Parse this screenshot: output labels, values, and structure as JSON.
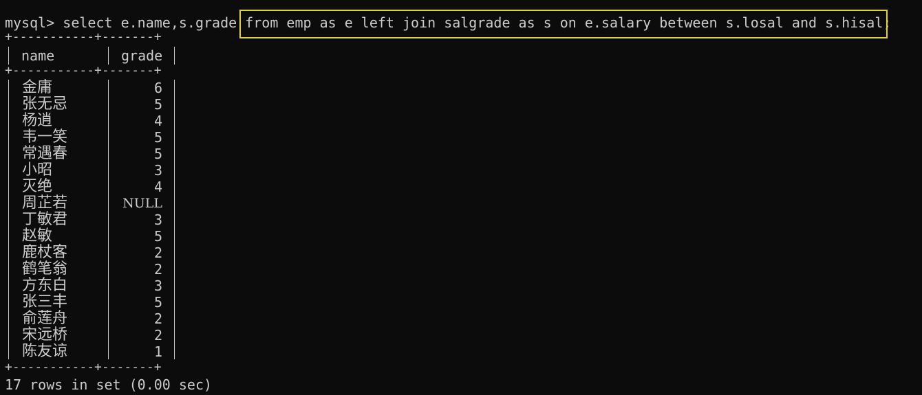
{
  "terminal": {
    "prompt": "mysql>",
    "command_prefix": " select e.name,s.grade ",
    "command_highlight": "from emp as e left join salgrade as s on e.salary between s.losal and s.hisal;",
    "border": "+-----------+-------+",
    "columns": [
      "name",
      "grade"
    ],
    "rows": [
      {
        "name": "金庸",
        "grade": "6"
      },
      {
        "name": "张无忌",
        "grade": "5"
      },
      {
        "name": "杨逍",
        "grade": "4"
      },
      {
        "name": "韦一笑",
        "grade": "5"
      },
      {
        "name": "常遇春",
        "grade": "5"
      },
      {
        "name": "小昭",
        "grade": "3"
      },
      {
        "name": "灭绝",
        "grade": "4"
      },
      {
        "name": "周芷若",
        "grade": "NULL"
      },
      {
        "name": "丁敏君",
        "grade": "3"
      },
      {
        "name": "赵敏",
        "grade": "5"
      },
      {
        "name": "鹿杖客",
        "grade": "2"
      },
      {
        "name": "鹤笔翁",
        "grade": "2"
      },
      {
        "name": "方东白",
        "grade": "3"
      },
      {
        "name": "张三丰",
        "grade": "5"
      },
      {
        "name": "俞莲舟",
        "grade": "2"
      },
      {
        "name": "宋远桥",
        "grade": "2"
      },
      {
        "name": "陈友谅",
        "grade": "1"
      }
    ],
    "footer": "17 rows in set (0.00 sec)"
  },
  "colors": {
    "background": "#0c0c0c",
    "text": "#cccccc",
    "highlight_border": "#e3d23a"
  }
}
